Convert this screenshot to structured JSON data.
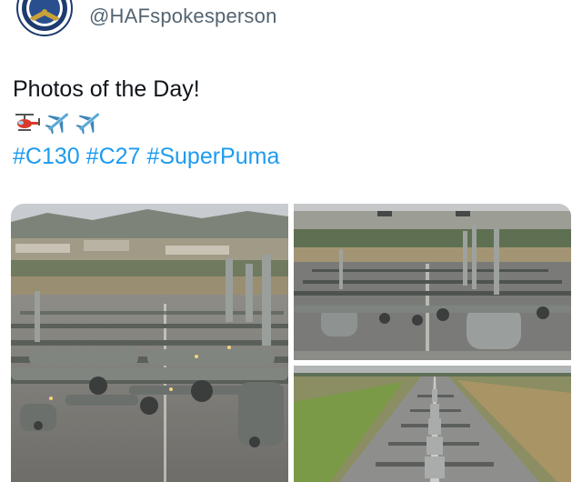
{
  "account": {
    "handle": "@HAFspokesperson",
    "avatar_icon": "air-force-emblem-icon"
  },
  "tweet": {
    "text": "Photos of the Day!",
    "emojis": [
      "helicopter-icon",
      "airplane-icon",
      "airplane-icon"
    ],
    "hashtags": [
      "#C130",
      "#C27",
      "#SuperPuma"
    ]
  },
  "media": {
    "photos": [
      {
        "name": "c130-elephant-walk-photo"
      },
      {
        "name": "aircraft-lineup-front-photo"
      },
      {
        "name": "runway-aerial-photo"
      }
    ]
  },
  "colors": {
    "link": "#1d9bf0",
    "handle": "#536471",
    "text": "#0f1419"
  }
}
